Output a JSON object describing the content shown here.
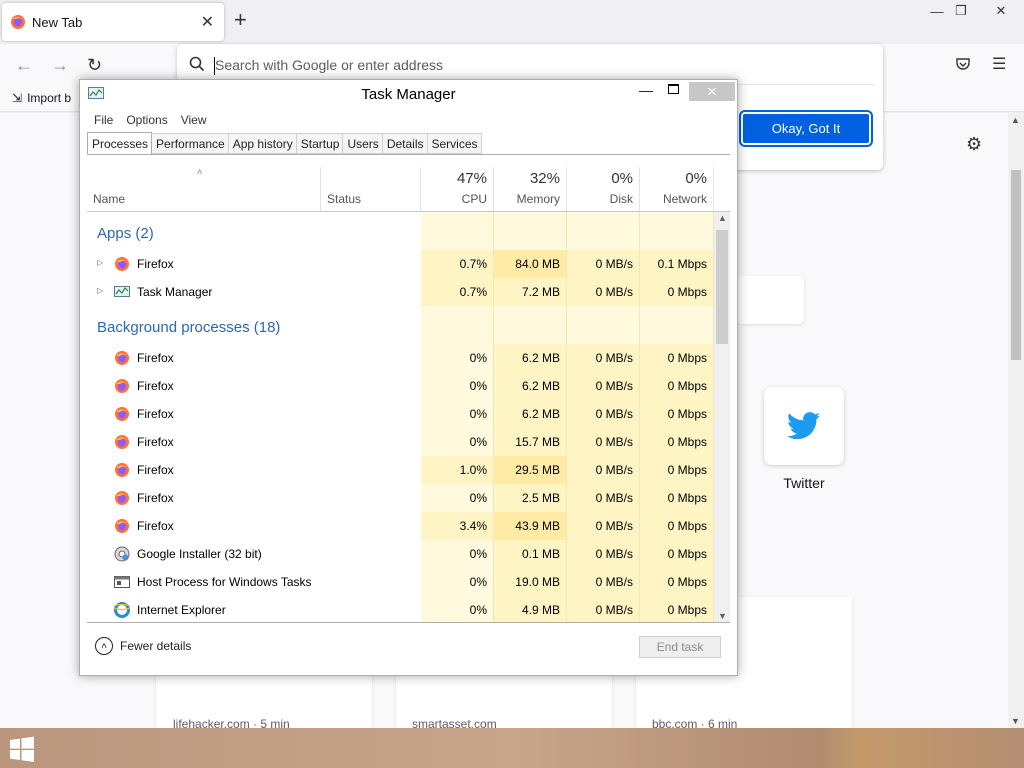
{
  "browser": {
    "tab_title": "New Tab",
    "tab_close": "✕",
    "new_tab": "+",
    "url_placeholder": "Search with Google or enter address",
    "okay_button": "Okay, Got It",
    "import_bookmarks": "Import b",
    "twitter_label": "Twitter",
    "stories": [
      "lifehacker.com · 5 min",
      "smartasset.com",
      "bbc.com · 6 min"
    ]
  },
  "task_manager": {
    "title": "Task Manager",
    "menu": [
      "File",
      "Options",
      "View"
    ],
    "tabs": [
      "Processes",
      "Performance",
      "App history",
      "Startup",
      "Users",
      "Details",
      "Services"
    ],
    "active_tab": "Processes",
    "columns": {
      "name": "Name",
      "status": "Status",
      "cpu": {
        "pct": "47%",
        "label": "CPU"
      },
      "memory": {
        "pct": "32%",
        "label": "Memory"
      },
      "disk": {
        "pct": "0%",
        "label": "Disk"
      },
      "network": {
        "pct": "0%",
        "label": "Network"
      }
    },
    "groups": [
      {
        "title": "Apps (2)",
        "rows": [
          {
            "name": "Firefox",
            "icon": "firefox",
            "expandable": true,
            "cpu": "0.7%",
            "memory": "84.0 MB",
            "disk": "0 MB/s",
            "network": "0.1 Mbps"
          },
          {
            "name": "Task Manager",
            "icon": "taskmgr",
            "expandable": true,
            "cpu": "0.7%",
            "memory": "7.2 MB",
            "disk": "0 MB/s",
            "network": "0 Mbps"
          }
        ]
      },
      {
        "title": "Background processes (18)",
        "rows": [
          {
            "name": "Firefox",
            "icon": "firefox",
            "cpu": "0%",
            "memory": "6.2 MB",
            "disk": "0 MB/s",
            "network": "0 Mbps"
          },
          {
            "name": "Firefox",
            "icon": "firefox",
            "cpu": "0%",
            "memory": "6.2 MB",
            "disk": "0 MB/s",
            "network": "0 Mbps"
          },
          {
            "name": "Firefox",
            "icon": "firefox",
            "cpu": "0%",
            "memory": "6.2 MB",
            "disk": "0 MB/s",
            "network": "0 Mbps"
          },
          {
            "name": "Firefox",
            "icon": "firefox",
            "cpu": "0%",
            "memory": "15.7 MB",
            "disk": "0 MB/s",
            "network": "0 Mbps"
          },
          {
            "name": "Firefox",
            "icon": "firefox",
            "cpu": "1.0%",
            "memory": "29.5 MB",
            "disk": "0 MB/s",
            "network": "0 Mbps"
          },
          {
            "name": "Firefox",
            "icon": "firefox",
            "cpu": "0%",
            "memory": "2.5 MB",
            "disk": "0 MB/s",
            "network": "0 Mbps"
          },
          {
            "name": "Firefox",
            "icon": "firefox",
            "cpu": "3.4%",
            "memory": "43.9 MB",
            "disk": "0 MB/s",
            "network": "0 Mbps"
          },
          {
            "name": "Google Installer (32 bit)",
            "icon": "installer",
            "cpu": "0%",
            "memory": "0.1 MB",
            "disk": "0 MB/s",
            "network": "0 Mbps"
          },
          {
            "name": "Host Process for Windows Tasks",
            "icon": "host",
            "cpu": "0%",
            "memory": "19.0 MB",
            "disk": "0 MB/s",
            "network": "0 Mbps"
          },
          {
            "name": "Internet Explorer",
            "icon": "ie",
            "cpu": "0%",
            "memory": "4.9 MB",
            "disk": "0 MB/s",
            "network": "0 Mbps"
          }
        ]
      }
    ],
    "fewer_details": "Fewer details",
    "end_task": "End task"
  },
  "colors": {
    "firefox_blue": "#0061e0",
    "group_title": "#2b68b4",
    "heat_light": "#fff4c4",
    "heat_medium": "#ffeaa6"
  }
}
